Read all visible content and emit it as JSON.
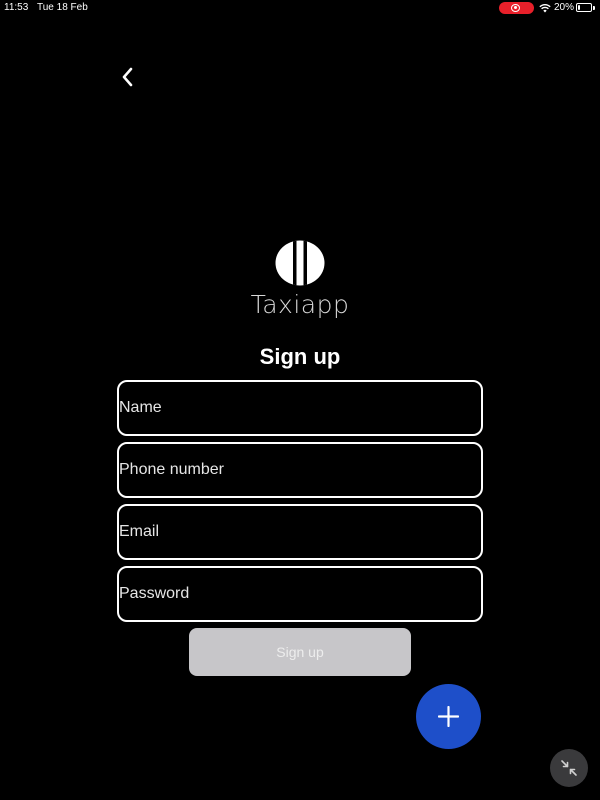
{
  "status_bar": {
    "time": "11:53",
    "date": "Tue 18 Feb",
    "battery_percent": "20%",
    "battery_level": 0.2,
    "recording_color": "#e8202a"
  },
  "nav": {
    "back_icon": "chevron-left-icon"
  },
  "brand": {
    "app_name": "Taxiapp",
    "logo_icon": "taxiapp-logo-icon"
  },
  "form": {
    "title": "Sign up",
    "fields": [
      {
        "placeholder": "Name",
        "value": ""
      },
      {
        "placeholder": "Phone number",
        "value": ""
      },
      {
        "placeholder": "Email",
        "value": ""
      },
      {
        "placeholder": "Password",
        "value": ""
      }
    ],
    "submit_label": "Sign up",
    "submit_color": "#c7c6c9"
  },
  "fab": {
    "icon": "plus-icon",
    "color": "#1e4fc9"
  },
  "minimize": {
    "icon": "minimize-arrows-icon"
  }
}
